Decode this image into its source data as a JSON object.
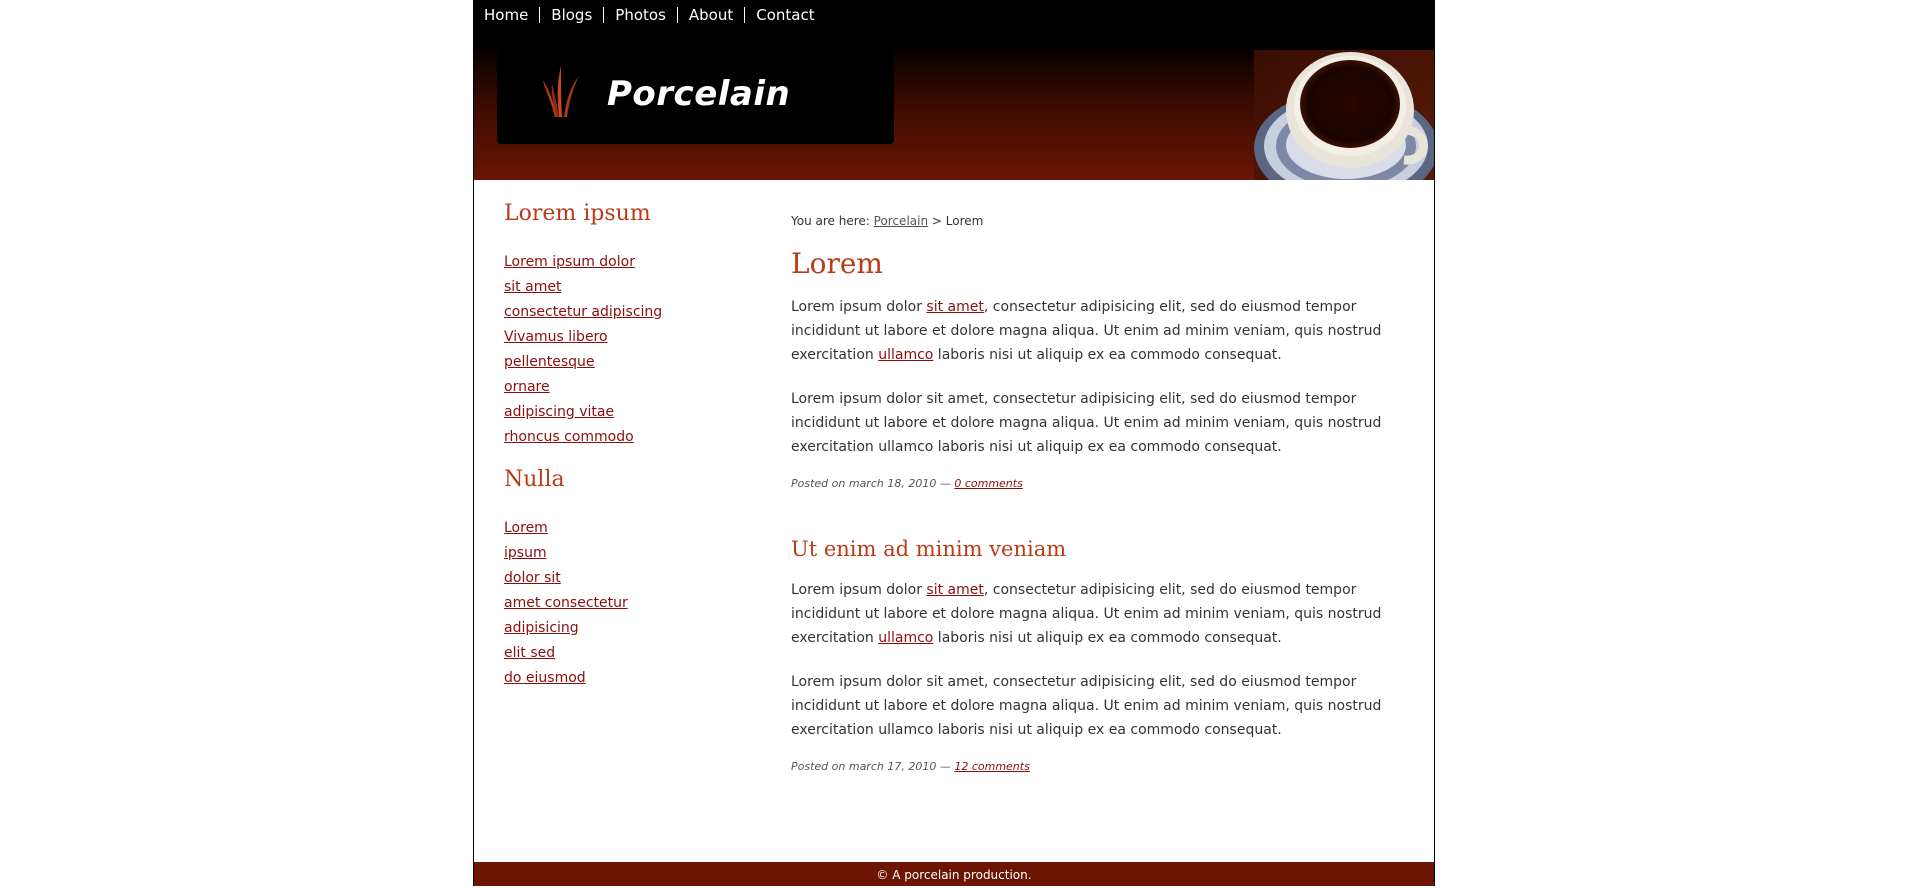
{
  "nav": {
    "items": [
      "Home",
      "Blogs",
      "Photos",
      "About",
      "Contact"
    ]
  },
  "logo": {
    "text": "Porcelain"
  },
  "sidebar": {
    "sections": [
      {
        "heading": "Lorem ipsum",
        "links": [
          "Lorem ipsum dolor",
          "sit amet",
          "consectetur adipiscing",
          "Vivamus libero",
          "pellentesque",
          "ornare",
          "adipiscing vitae",
          "rhoncus commodo"
        ]
      },
      {
        "heading": "Nulla",
        "links": [
          "Lorem",
          "ipsum",
          "dolor sit",
          "amet consectetur",
          "adipisicing",
          "elit sed",
          "do eiusmod"
        ]
      }
    ]
  },
  "breadcrumb": {
    "prefix": "You are here:",
    "link": "Porcelain",
    "separator": ">",
    "current": "Lorem"
  },
  "posts": [
    {
      "title": "Lorem",
      "p1": {
        "a": "Lorem ipsum dolor ",
        "link1": "sit amet",
        "b": ", consectetur adipisicing elit, sed do eiusmod tempor incididunt ut labore et dolore magna aliqua. Ut enim ad minim veniam, quis nostrud exercitation ",
        "link2": "ullamco",
        "c": " laboris nisi ut aliquip ex ea commodo consequat."
      },
      "p2": "Lorem ipsum dolor sit amet, consectetur adipisicing elit, sed do eiusmod tempor incididunt ut labore et dolore magna aliqua. Ut enim ad minim veniam, quis nostrud exercitation ullamco laboris nisi ut aliquip ex ea commodo consequat.",
      "meta": "Posted on march 18, 2010 —",
      "comments": "0 comments"
    },
    {
      "title": "Ut enim ad minim veniam",
      "p1": {
        "a": "Lorem ipsum dolor ",
        "link1": "sit amet",
        "b": ", consectetur adipisicing elit, sed do eiusmod tempor incididunt ut labore et dolore magna aliqua. Ut enim ad minim veniam, quis nostrud exercitation ",
        "link2": "ullamco",
        "c": " laboris nisi ut aliquip ex ea commodo consequat."
      },
      "p2": "Lorem ipsum dolor sit amet, consectetur adipisicing elit, sed do eiusmod tempor incididunt ut labore et dolore magna aliqua. Ut enim ad minim veniam, quis nostrud exercitation ullamco laboris nisi ut aliquip ex ea commodo consequat.",
      "meta": "Posted on march 17, 2010 —",
      "comments": "12 comments"
    }
  ],
  "footer": {
    "text": "© A porcelain production."
  },
  "colors": {
    "accent": "#b83c1a",
    "link": "#8a0e0e",
    "header_dark": "#000000",
    "header_red": "#6b1502"
  },
  "icons": {
    "logo": "grass-flame-icon",
    "photo": "coffee-cup-image"
  }
}
